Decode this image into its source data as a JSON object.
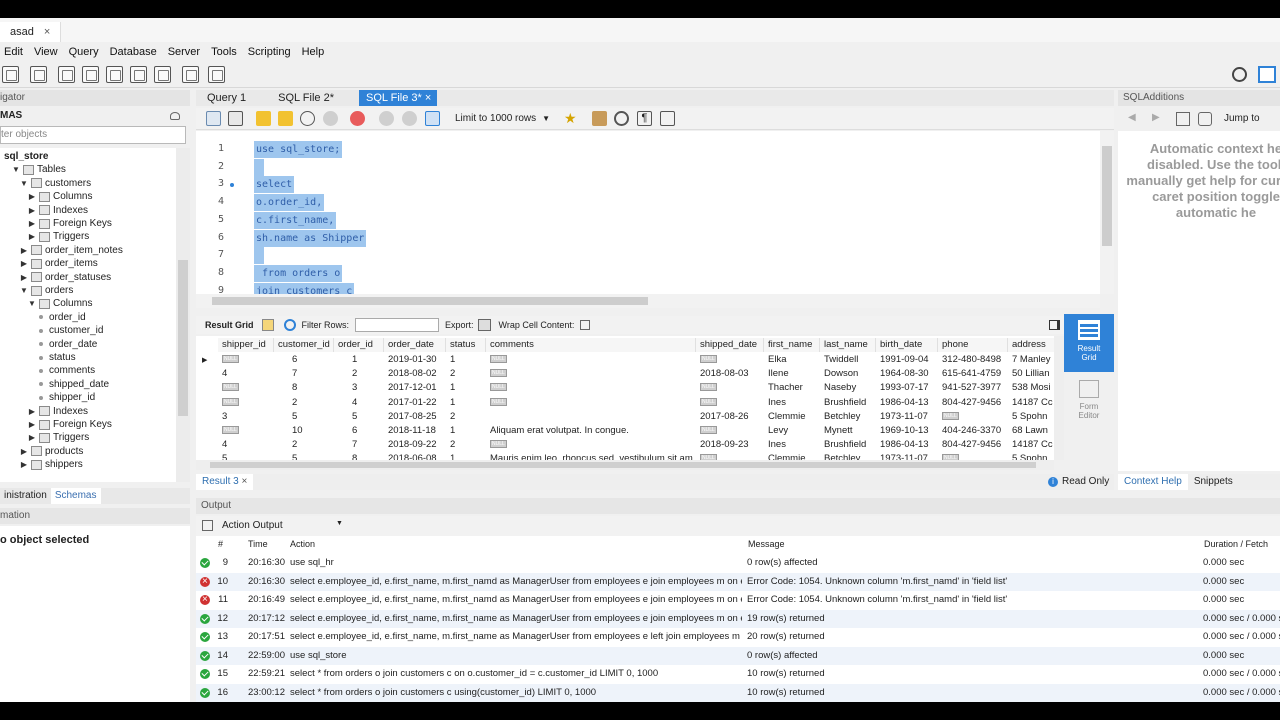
{
  "connection_tab": {
    "label": "asad",
    "close": "×"
  },
  "menu": [
    "Edit",
    "View",
    "Query",
    "Database",
    "Server",
    "Tools",
    "Scripting",
    "Help"
  ],
  "navigator": {
    "header": "igator",
    "schemas_title": "MAS",
    "filter_placeholder": "ter objects",
    "tree": [
      {
        "label": "sql_store",
        "level": 0,
        "twisty": "",
        "bold": true
      },
      {
        "label": "Tables",
        "level": 1,
        "twisty": "▼"
      },
      {
        "label": "customers",
        "level": 2,
        "twisty": "▼"
      },
      {
        "label": "Columns",
        "level": 3,
        "twisty": "▶"
      },
      {
        "label": "Indexes",
        "level": 3,
        "twisty": "▶"
      },
      {
        "label": "Foreign Keys",
        "level": 3,
        "twisty": "▶"
      },
      {
        "label": "Triggers",
        "level": 3,
        "twisty": "▶"
      },
      {
        "label": "order_item_notes",
        "level": 2,
        "twisty": "▶"
      },
      {
        "label": "order_items",
        "level": 2,
        "twisty": "▶"
      },
      {
        "label": "order_statuses",
        "level": 2,
        "twisty": "▶"
      },
      {
        "label": "orders",
        "level": 2,
        "twisty": "▼"
      },
      {
        "label": "Columns",
        "level": 3,
        "twisty": "▼"
      },
      {
        "label": "order_id",
        "level": 4,
        "twisty": "",
        "col": true
      },
      {
        "label": "customer_id",
        "level": 4,
        "twisty": "",
        "col": true
      },
      {
        "label": "order_date",
        "level": 4,
        "twisty": "",
        "col": true
      },
      {
        "label": "status",
        "level": 4,
        "twisty": "",
        "col": true
      },
      {
        "label": "comments",
        "level": 4,
        "twisty": "",
        "col": true
      },
      {
        "label": "shipped_date",
        "level": 4,
        "twisty": "",
        "col": true
      },
      {
        "label": "shipper_id",
        "level": 4,
        "twisty": "",
        "col": true
      },
      {
        "label": "Indexes",
        "level": 3,
        "twisty": "▶"
      },
      {
        "label": "Foreign Keys",
        "level": 3,
        "twisty": "▶"
      },
      {
        "label": "Triggers",
        "level": 3,
        "twisty": "▶"
      },
      {
        "label": "products",
        "level": 2,
        "twisty": "▶"
      },
      {
        "label": "shippers",
        "level": 2,
        "twisty": "▶"
      }
    ],
    "bottom_tabs": [
      "inistration",
      "Schemas"
    ],
    "info_header": "mation",
    "info_text": "o object selected"
  },
  "editor_tabs": [
    "Query 1",
    "SQL File 2*",
    "SQL File 3*"
  ],
  "editor_tab_close": "×",
  "limit_select": "Limit to 1000 rows",
  "code_lines": [
    {
      "num": "1",
      "text": "use sql_store;"
    },
    {
      "num": "2",
      "text": " "
    },
    {
      "num": "3",
      "text": "select",
      "dot": true
    },
    {
      "num": "4",
      "text": "o.order_id,"
    },
    {
      "num": "5",
      "text": "c.first_name,"
    },
    {
      "num": "6",
      "text": "sh.name as Shipper"
    },
    {
      "num": "7",
      "text": " "
    },
    {
      "num": "8",
      "text": " from orders o"
    },
    {
      "num": "9",
      "text": "join customers c"
    }
  ],
  "result_toolbar": {
    "result_grid": "Result Grid",
    "filter_rows": "Filter Rows:",
    "export": "Export:",
    "wrap": "Wrap Cell Content:"
  },
  "grid": {
    "columns": [
      "shipper_id",
      "customer_id",
      "order_id",
      "order_date",
      "status",
      "comments",
      "shipped_date",
      "first_name",
      "last_name",
      "birth_date",
      "phone",
      "address"
    ],
    "null_label": "NULL",
    "rows": [
      [
        "NULL",
        "6",
        "1",
        "2019-01-30",
        "1",
        "NULL",
        "NULL",
        "Elka",
        "Twiddell",
        "1991-09-04",
        "312-480-8498",
        "7 Manley"
      ],
      [
        "4",
        "7",
        "2",
        "2018-08-02",
        "2",
        "NULL",
        "2018-08-03",
        "Ilene",
        "Dowson",
        "1964-08-30",
        "615-641-4759",
        "50 Lillian"
      ],
      [
        "NULL",
        "8",
        "3",
        "2017-12-01",
        "1",
        "NULL",
        "NULL",
        "Thacher",
        "Naseby",
        "1993-07-17",
        "941-527-3977",
        "538 Mosi"
      ],
      [
        "NULL",
        "2",
        "4",
        "2017-01-22",
        "1",
        "NULL",
        "NULL",
        "Ines",
        "Brushfield",
        "1986-04-13",
        "804-427-9456",
        "14187 Cc"
      ],
      [
        "3",
        "5",
        "5",
        "2017-08-25",
        "2",
        "",
        "2017-08-26",
        "Clemmie",
        "Betchley",
        "1973-11-07",
        "NULL",
        "5 Spohn"
      ],
      [
        "NULL",
        "10",
        "6",
        "2018-11-18",
        "1",
        "Aliquam erat volutpat. In congue.",
        "NULL",
        "Levy",
        "Mynett",
        "1969-10-13",
        "404-246-3370",
        "68 Lawn"
      ],
      [
        "4",
        "2",
        "7",
        "2018-09-22",
        "2",
        "NULL",
        "2018-09-23",
        "Ines",
        "Brushfield",
        "1986-04-13",
        "804-427-9456",
        "14187 Cc"
      ],
      [
        "5",
        "5",
        "8",
        "2018-06-08",
        "1",
        "Mauris enim leo, rhoncus sed, vestibulum sit am",
        "NULL",
        "Clemmie",
        "Betchley",
        "1973-11-07",
        "NULL",
        "5 Spohn"
      ]
    ]
  },
  "side_buttons": {
    "result_grid": "Result Grid",
    "form_editor": "Form Editor"
  },
  "result_tab": "Result 3",
  "read_only": "Read Only",
  "sql_additions": {
    "header": "SQLAdditions",
    "jump_to": "Jump to",
    "message": "Automatic context he disabled. Use the tooll manually get help for current caret position toggle automatic he",
    "tabs": [
      "Context Help",
      "Snippets"
    ]
  },
  "output": {
    "header": "Output",
    "mode": "Action Output",
    "columns": [
      "#",
      "Time",
      "Action",
      "Message",
      "Duration / Fetch"
    ],
    "rows": [
      {
        "status": "ok",
        "num": "9",
        "time": "20:16:30",
        "action": "use sql_hr",
        "message": "0 row(s) affected",
        "duration": "0.000 sec"
      },
      {
        "status": "err",
        "num": "10",
        "time": "20:16:30",
        "action": "select  e.employee_id, e.first_name,      m.first_namd as ManagerUser  from employees e join employees m on e.r...",
        "message": "Error Code: 1054. Unknown column 'm.first_namd' in 'field list'",
        "duration": "0.000 sec"
      },
      {
        "status": "err",
        "num": "11",
        "time": "20:16:49",
        "action": "select  e.employee_id, e.first_name,      m.first_namd as ManagerUser  from employees e join employees m on e.r...",
        "message": "Error Code: 1054. Unknown column 'm.first_namd' in 'field list'",
        "duration": "0.000 sec"
      },
      {
        "status": "ok",
        "num": "12",
        "time": "20:17:12",
        "action": "select  e.employee_id, e.first_name,      m.first_name as ManagerUser  from employees e join employees m on e.r...",
        "message": "19 row(s) returned",
        "duration": "0.000 sec / 0.000 s"
      },
      {
        "status": "ok",
        "num": "13",
        "time": "20:17:51",
        "action": "select  e.employee_id, e.first_name,      m.first_name as ManagerUser  from employees e left join employees m o...",
        "message": "20 row(s) returned",
        "duration": "0.000 sec / 0.000 s"
      },
      {
        "status": "ok",
        "num": "14",
        "time": "22:59:00",
        "action": "use sql_store",
        "message": "0 row(s) affected",
        "duration": "0.000 sec"
      },
      {
        "status": "ok",
        "num": "15",
        "time": "22:59:21",
        "action": "select * from orders o  join customers c    on o.customer_id = c.customer_id LIMIT 0, 1000",
        "message": "10 row(s) returned",
        "duration": "0.000 sec / 0.000 s"
      },
      {
        "status": "ok",
        "num": "16",
        "time": "23:00:12",
        "action": "select * from orders o  join customers c    using(customer_id) LIMIT 0, 1000",
        "message": "10 row(s) returned",
        "duration": "0.000 sec / 0.000 s"
      }
    ]
  },
  "colors": {
    "accent": "#2f82d7",
    "selection": "#9ec6ee",
    "ok": "#2aa63e",
    "error": "#d03232"
  }
}
